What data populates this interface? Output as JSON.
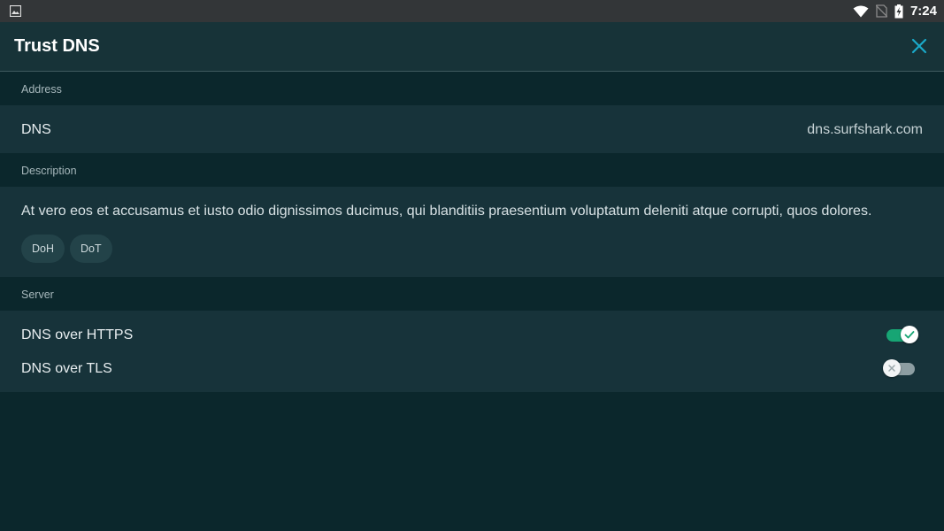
{
  "statusbar": {
    "left_icon": "image-icon",
    "icons": [
      "wifi-icon",
      "no-sim-icon",
      "battery-charging-icon"
    ],
    "time": "7:24"
  },
  "appbar": {
    "title": "Trust DNS",
    "close_icon": "close-icon",
    "accent_color": "#1aa9c9"
  },
  "sections": {
    "address": {
      "header": "Address",
      "label": "DNS",
      "value": "dns.surfshark.com"
    },
    "description": {
      "header": "Description",
      "text": "At vero eos et accusamus et iusto odio dignissimos ducimus, qui blanditiis praesentium voluptatum deleniti atque corrupti, quos dolores.",
      "chips": [
        "DoH",
        "DoT"
      ]
    },
    "server": {
      "header": "Server",
      "options": [
        {
          "label": "DNS over HTTPS",
          "enabled": true
        },
        {
          "label": "DNS over TLS",
          "enabled": false
        }
      ]
    }
  },
  "colors": {
    "background": "#0b272c",
    "card": "#17333a",
    "toggle_on": "#17a574"
  }
}
